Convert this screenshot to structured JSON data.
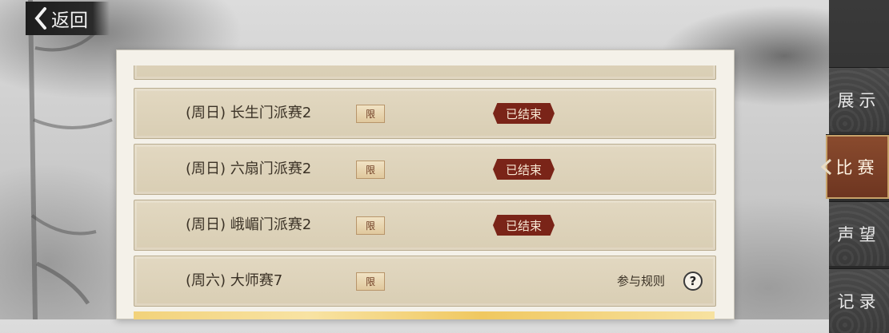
{
  "header": {
    "back_label": "返回"
  },
  "tabs": [
    {
      "label": "展示",
      "active": false
    },
    {
      "label": "比赛",
      "active": true
    },
    {
      "label": "声望",
      "active": false
    },
    {
      "label": "记录",
      "active": false
    }
  ],
  "matches": [
    {
      "name": "(周日) 长生门派赛2",
      "limit": "限",
      "status": "已结束"
    },
    {
      "name": "(周日) 六扇门派赛2",
      "limit": "限",
      "status": "已结束"
    },
    {
      "name": "(周日) 峨嵋门派赛2",
      "limit": "限",
      "status": "已结束"
    },
    {
      "name": "(周六) 大师赛7",
      "limit": "限",
      "rules_label": "参与规则",
      "help": "?"
    }
  ],
  "colors": {
    "ended_badge": "#7a2418",
    "active_tab": "#8a4b2e",
    "row_bg": "#e2d8c1"
  },
  "icons": [
    "chevron-left-icon",
    "help-icon"
  ]
}
